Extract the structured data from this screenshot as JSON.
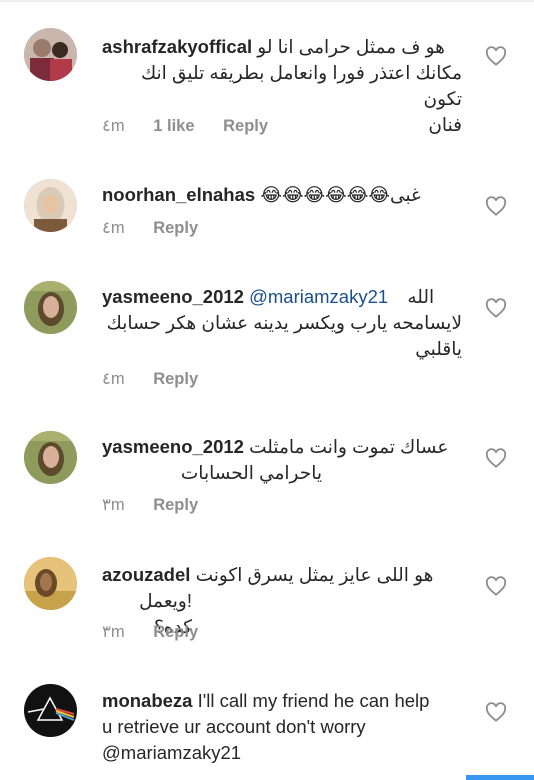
{
  "comments": [
    {
      "username": "ashrafzakyoffical",
      "mention": "",
      "text_lines": [
        "هو ف ممثل حرامى انا لو",
        "مكانك اعتذر فورا وانعامل بطريقه تليق انك تكون",
        "فنان"
      ],
      "time": "٤m",
      "likes": "1 like",
      "reply": "Reply",
      "avatar_colors": [
        "#9a7a6b",
        "#c9b7ad",
        "#7b2b3a"
      ]
    },
    {
      "username": "noorhan_elnahas",
      "mention": "",
      "text_lines": [
        "غبى😂😂😂😂😂😂"
      ],
      "time": "٤m",
      "likes": "",
      "reply": "Reply",
      "avatar_colors": [
        "#d9c9b8",
        "#7e5a3c",
        "#efe2d3"
      ]
    },
    {
      "username": "yasmeeno_2012",
      "mention": "@mariamzaky21",
      "text_lines": [
        "الله",
        "لايسامحه يارب ويكسر يدينه عشان هكر حسابك",
        "ياقلبي"
      ],
      "time": "٤m",
      "likes": "",
      "reply": "Reply",
      "avatar_colors": [
        "#8f9a5d",
        "#d7b09a",
        "#5d4a2d"
      ]
    },
    {
      "username": "yasmeeno_2012",
      "mention": "",
      "text_lines": [
        "عساك تموت وانت مامثلت",
        "ياحرامي الحسابات"
      ],
      "time": "٣m",
      "likes": "",
      "reply": "Reply",
      "avatar_colors": [
        "#8f9a5d",
        "#d7b09a",
        "#5d4a2d"
      ]
    },
    {
      "username": "azouzadel",
      "mention": "",
      "text_lines": [
        "هو اللى عايز يمثل يسرق اكونت",
        "!ويعمل كده؟"
      ],
      "time": "٣m",
      "likes": "",
      "reply": "Reply",
      "avatar_colors": [
        "#c7a24a",
        "#6b4a28",
        "#e6c27a"
      ]
    },
    {
      "username": "monabeza",
      "mention": "",
      "text_lines": [
        "I'll call my friend he can help",
        "u retrieve ur account don't worry",
        "@mariamzaky21"
      ],
      "time": "",
      "likes": "",
      "reply": "",
      "avatar_colors": [
        "#111111",
        "#ffffff",
        "#e04a3a"
      ]
    }
  ],
  "icons": {
    "like": "heart-outline-icon"
  },
  "colors": {
    "username": "#262626",
    "mention": "#1b4f8f",
    "meta": "#8e8e8e",
    "accent": "#3897f0"
  }
}
